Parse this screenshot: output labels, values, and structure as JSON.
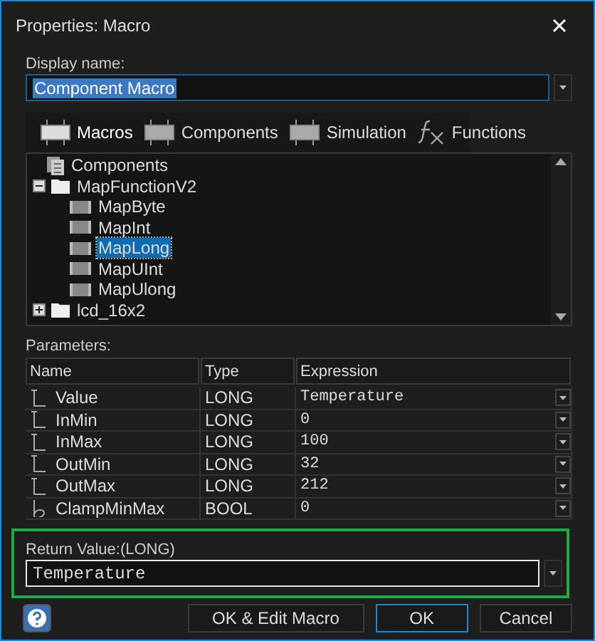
{
  "window": {
    "title": "Properties: Macro"
  },
  "display_name": {
    "label": "Display name:",
    "value": "Component Macro"
  },
  "tabs": [
    {
      "label": "Macros",
      "kind": "chip",
      "selected": true
    },
    {
      "label": "Components",
      "kind": "chip",
      "selected": false
    },
    {
      "label": "Simulation",
      "kind": "chip",
      "selected": false
    },
    {
      "label": "Functions",
      "kind": "fx",
      "selected": false
    }
  ],
  "tree": [
    {
      "label": "Components",
      "kind": "root",
      "children": [
        {
          "label": "MapFunctionV2",
          "kind": "folder",
          "expanded": true,
          "children": [
            {
              "label": "MapByte",
              "kind": "macro",
              "selected": false
            },
            {
              "label": "MapInt",
              "kind": "macro",
              "selected": false
            },
            {
              "label": "MapLong",
              "kind": "macro",
              "selected": true
            },
            {
              "label": "MapUInt",
              "kind": "macro",
              "selected": false
            },
            {
              "label": "MapUlong",
              "kind": "macro",
              "selected": false
            }
          ]
        },
        {
          "label": "lcd_16x2",
          "kind": "folder",
          "expanded": false
        }
      ]
    }
  ],
  "parameters": {
    "label": "Parameters:",
    "columns": [
      "Name",
      "Type",
      "Expression"
    ],
    "rows": [
      {
        "kind": "long",
        "name": "Value",
        "type": "LONG",
        "expression": "Temperature"
      },
      {
        "kind": "long",
        "name": "InMin",
        "type": "LONG",
        "expression": "0"
      },
      {
        "kind": "long",
        "name": "InMax",
        "type": "LONG",
        "expression": "100"
      },
      {
        "kind": "long",
        "name": "OutMin",
        "type": "LONG",
        "expression": "32"
      },
      {
        "kind": "long",
        "name": "OutMax",
        "type": "LONG",
        "expression": "212"
      },
      {
        "kind": "bool",
        "name": "ClampMinMax",
        "type": "BOOL",
        "expression": "0"
      }
    ]
  },
  "return_value": {
    "label": "Return Value:(LONG)",
    "value": "Temperature"
  },
  "buttons": [
    {
      "label": "OK & Edit Macro",
      "default": false
    },
    {
      "label": "OK",
      "default": true
    },
    {
      "label": "Cancel",
      "default": false
    }
  ]
}
